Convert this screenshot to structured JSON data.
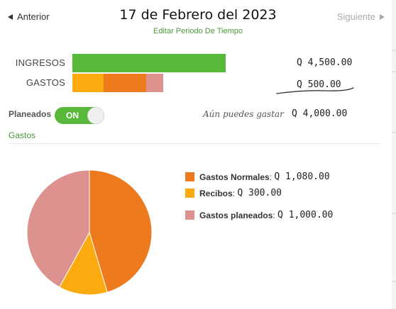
{
  "header": {
    "prev_label": "Anterior",
    "next_label": "Siguiente",
    "title": "17 de Febrero del 2023",
    "edit_period_label": "Editar Periodo De Tiempo"
  },
  "summary": {
    "income_label": "INGRESOS",
    "income_amount": "Q 4,500.00",
    "expense_label": "GASTOS",
    "expense_amount": "Q 500.00",
    "planned_label": "Planeados",
    "toggle_label": "ON",
    "toggle_on": true,
    "can_spend_label": "Aún puedes gastar",
    "can_spend_amount": "Q 4,000.00"
  },
  "colors": {
    "income": "#57b83a",
    "accent_green": "#4a9a3a",
    "normal_expenses": "#ee7a1e",
    "receipts": "#fbaa0f",
    "planned_expenses": "#de9290"
  },
  "section_title": "Gastos",
  "chart_data": {
    "type": "pie",
    "series": [
      {
        "name": "Gastos Normales",
        "value": 1080,
        "display": "Q 1,080.00",
        "color": "#ee7a1e"
      },
      {
        "name": "Recibos",
        "value": 300,
        "display": "Q 300.00",
        "color": "#fbaa0f"
      },
      {
        "name": "Gastos planeados",
        "value": 1000,
        "display": "Q 1,000.00",
        "color": "#de9290"
      }
    ],
    "legend_position": "right"
  }
}
